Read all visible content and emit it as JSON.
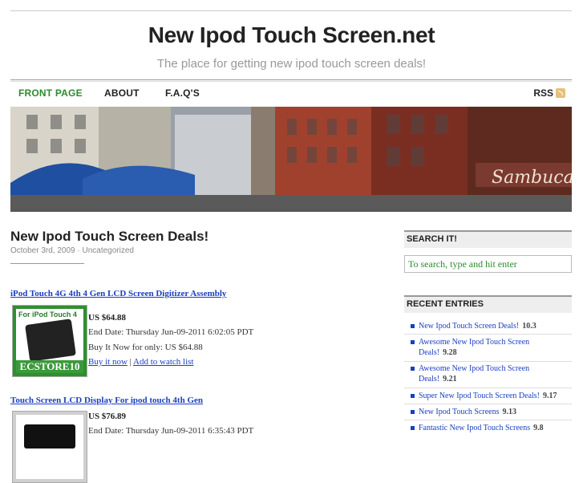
{
  "site": {
    "title": "New Ipod Touch Screen.net",
    "description": "The place for getting new ipod touch screen deals!"
  },
  "nav": {
    "items": [
      "FRONT PAGE",
      "ABOUT",
      "F.A.Q'S"
    ],
    "rss_label": "RSS"
  },
  "post": {
    "title": "New Ipod Touch Screen Deals!",
    "meta": "October 3rd, 2009 · Uncategorized"
  },
  "listings": [
    {
      "title": "iPod Touch 4G 4th 4 Gen LCD Screen Digitizer Assembly",
      "thumb_top": "For iPod Touch 4",
      "thumb_bottom": "ECSTORE10",
      "price": "US $64.88",
      "end_date": "End Date: Thursday Jun-09-2011 6:02:05 PDT",
      "buy_now": "Buy It Now for only: US $64.88",
      "buy_link": "Buy it now",
      "sep": " | ",
      "watch_link": "Add to watch list"
    },
    {
      "title": "Touch Screen LCD Display For ipod touch 4th Gen",
      "price": "US $76.89",
      "end_date": "End Date: Thursday Jun-09-2011 6:35:43 PDT"
    }
  ],
  "sidebar": {
    "search_heading": "SEARCH IT!",
    "search_placeholder": "To search, type and hit enter",
    "recent_heading": "RECENT ENTRIES",
    "entries": [
      {
        "title": "New Ipod Touch Screen Deals!",
        "score": "10.3"
      },
      {
        "title": "Awesome New Ipod Touch Screen Deals!",
        "score": "9.28"
      },
      {
        "title": "Awesome New Ipod Touch Screen Deals!",
        "score": "9.21"
      },
      {
        "title": "Super New Ipod Touch Screen Deals!",
        "score": "9.17"
      },
      {
        "title": "New Ipod Touch Screens",
        "score": "9.13"
      },
      {
        "title": "Fantastic New Ipod Touch Screens",
        "score": "9.8"
      }
    ]
  },
  "colors": {
    "accent_green": "#2d8b2d",
    "link_blue": "#1a3fbf"
  }
}
